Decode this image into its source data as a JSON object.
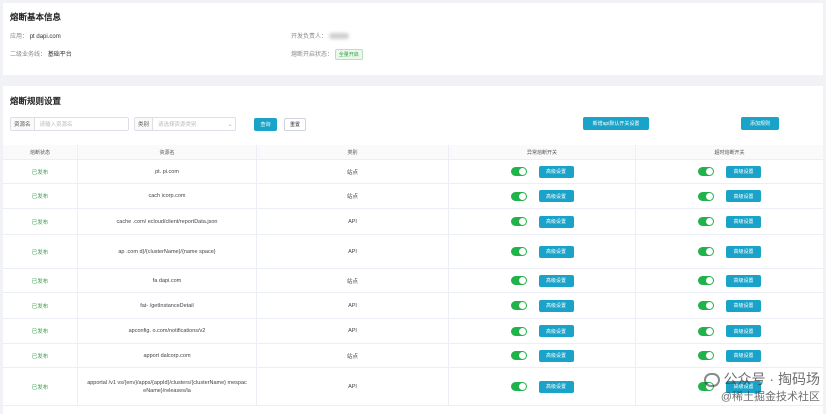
{
  "info": {
    "title": "熔断基本信息",
    "app_label": "应用：",
    "app_value": "pt          dapi.com",
    "owner_label": "开发负责人：",
    "owner_value": "",
    "biz_label": "二级业务线：",
    "biz_value": "基础平台",
    "state_label": "熔断开启状态：",
    "state_value": "全量开启"
  },
  "rules": {
    "title": "熔断规则设置",
    "filter_resource_label": "资源名",
    "filter_resource_placeholder": "请输入资源名",
    "filter_type_label": "类别",
    "filter_type_placeholder": "请选择资源类别",
    "search_btn": "查询",
    "reset_btn": "重置",
    "add_api_btn": "新增api默认开关设置",
    "add_rule_btn": "添加规则",
    "columns": [
      "熔断状态",
      "资源名",
      "类别",
      "异常熔断开关",
      "超时熔断开关"
    ],
    "advanced_label": "高级设置",
    "rows": [
      {
        "status": "已发布",
        "resource": "pt.          pi.com",
        "type": "站点"
      },
      {
        "status": "已发布",
        "resource": "cach          icorp.com",
        "type": "站点"
      },
      {
        "status": "已发布",
        "resource": "cache          .com/          ecloud/client/reportData.json",
        "type": "API"
      },
      {
        "status": "已发布",
        "resource": "ap          .com          d}/{clusterName}/{name          space}",
        "type": "API"
      },
      {
        "status": "已发布",
        "resource": "fa          dapi.com",
        "type": "站点"
      },
      {
        "status": "已发布",
        "resource": "fat-          /getInstanceDetail",
        "type": "API"
      },
      {
        "status": "已发布",
        "resource": "apconfig.          o.com/notifications/v2",
        "type": "API"
      },
      {
        "status": "已发布",
        "resource": "apport          dalcorp.com",
        "type": "站点"
      },
      {
        "status": "已发布",
        "resource": "apportal          /v1          vs/{env}/apps/{appId}/clusters/{clusterName}          mespaceName}/releases/la",
        "type": "API"
      }
    ]
  },
  "watermark": {
    "line1": "公众号 · 掏码场",
    "line2": "@稀土掘金技术社区"
  }
}
